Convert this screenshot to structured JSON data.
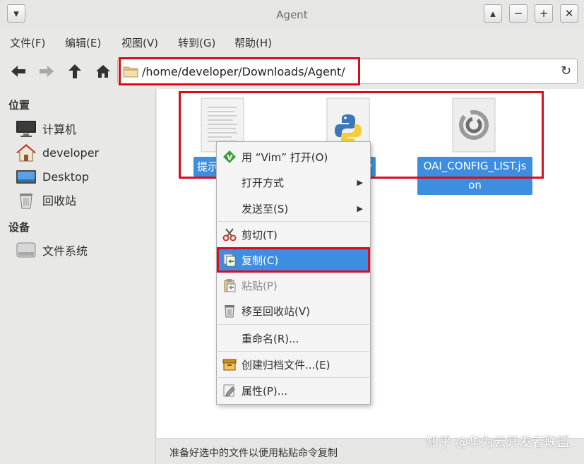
{
  "window": {
    "title": "Agent",
    "buttons": [
      "▾",
      "▴",
      "−",
      "+",
      "✕"
    ]
  },
  "menubar": [
    "文件(F)",
    "编辑(E)",
    "视图(V)",
    "转到(G)",
    "帮助(H)"
  ],
  "location": {
    "path": "/home/developer/Downloads/Agent/"
  },
  "sidebar": {
    "places_header": "位置",
    "places": [
      "计算机",
      "developer",
      "Desktop",
      "回收站"
    ],
    "devices_header": "设备",
    "devices": [
      "文件系统"
    ]
  },
  "files": [
    {
      "label": "提示"
    },
    {
      "label_right": "y"
    },
    {
      "label_line1": "OAI_CONFIG_LIST.js",
      "label_line2": "on"
    }
  ],
  "context_menu": {
    "items": [
      {
        "label": "用 “Vim” 打开(O)",
        "icon": "vim-icon"
      },
      {
        "label": "打开方式",
        "submenu": true
      },
      {
        "label": "发送至(S)",
        "submenu": true
      },
      {
        "label": "剪切(T)",
        "icon": "scissors-icon"
      },
      {
        "label": "复制(C)",
        "icon": "copy-icon",
        "active": true
      },
      {
        "label": "粘贴(P)",
        "icon": "paste-icon",
        "disabled": true
      },
      {
        "label": "移至回收站(V)",
        "icon": "trash-icon"
      },
      {
        "label": "重命名(R)..."
      },
      {
        "label": "创建归档文件...(E)",
        "icon": "archive-icon"
      },
      {
        "label": "属性(P)...",
        "icon": "properties-icon"
      }
    ]
  },
  "statusbar": {
    "text": "准备好选中的文件以便用粘贴命令复制"
  },
  "watermark": "知乎 @华为云开发者联盟",
  "colors": {
    "accent": "#3d8ee0",
    "highlight_box": "#d80c1c"
  }
}
